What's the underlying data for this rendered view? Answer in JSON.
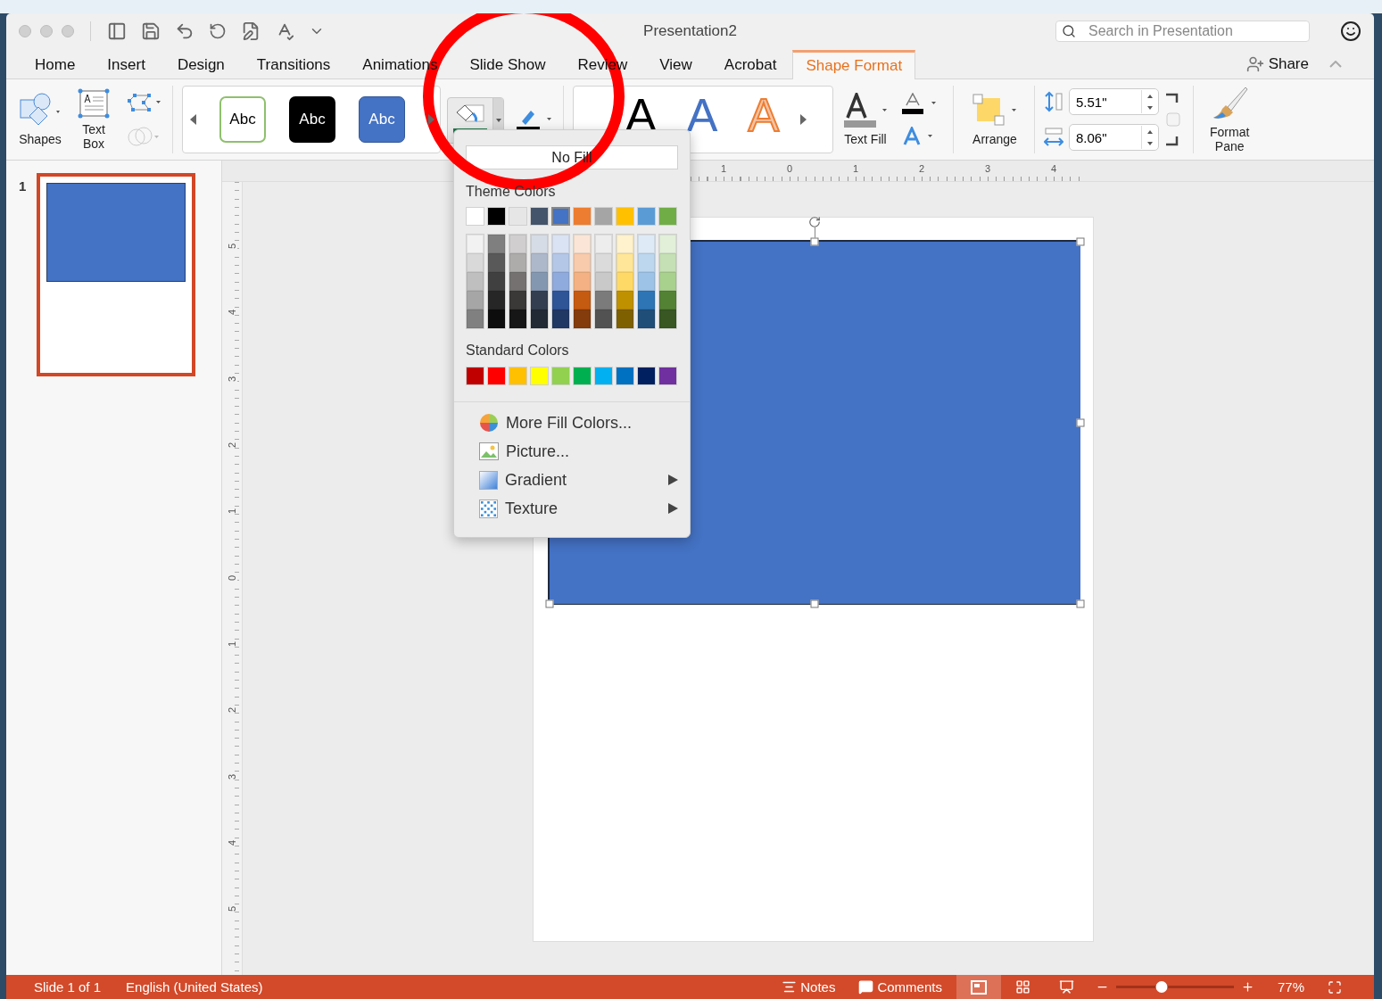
{
  "window": {
    "title": "Presentation2"
  },
  "search": {
    "placeholder": "Search in Presentation"
  },
  "tabs": [
    {
      "label": "Home",
      "selected": false
    },
    {
      "label": "Insert",
      "selected": false
    },
    {
      "label": "Design",
      "selected": false
    },
    {
      "label": "Transitions",
      "selected": false
    },
    {
      "label": "Animations",
      "selected": false
    },
    {
      "label": "Slide Show",
      "selected": false
    },
    {
      "label": "Review",
      "selected": false
    },
    {
      "label": "View",
      "selected": false
    },
    {
      "label": "Acrobat",
      "selected": false
    },
    {
      "label": "Shape Format",
      "selected": true
    }
  ],
  "share": {
    "label": "Share"
  },
  "ribbon": {
    "shapes": {
      "label": "Shapes"
    },
    "text_box": {
      "label": "Text Box"
    },
    "shape_styles": [
      {
        "label": "Abc",
        "kind": "outline"
      },
      {
        "label": "Abc",
        "kind": "dark"
      },
      {
        "label": "Abc",
        "kind": "blue"
      }
    ],
    "wordart": [
      {
        "label": "A",
        "kind": "black"
      },
      {
        "label": "A",
        "kind": "blue"
      },
      {
        "label": "A",
        "kind": "orange"
      }
    ],
    "text_fill": {
      "label": "Text Fill"
    },
    "arrange": {
      "label": "Arrange"
    },
    "size": [
      {
        "kind": "height",
        "value": "5.51\""
      },
      {
        "kind": "width",
        "value": "8.06\""
      }
    ],
    "format_pane": {
      "label": "Format Pane"
    }
  },
  "fill_menu": {
    "no_fill": "No Fill",
    "theme_heading": "Theme Colors",
    "theme_colors": [
      {
        "color": "#ffffff",
        "selected": false,
        "shades": [
          {
            "color": "#f2f2f2"
          },
          {
            "color": "#d9d9d9"
          },
          {
            "color": "#bfbfbf"
          },
          {
            "color": "#a6a6a6"
          },
          {
            "color": "#808080"
          }
        ]
      },
      {
        "color": "#000000",
        "selected": false,
        "shades": [
          {
            "color": "#7f7f7f"
          },
          {
            "color": "#595959"
          },
          {
            "color": "#404040"
          },
          {
            "color": "#262626"
          },
          {
            "color": "#0d0d0d"
          }
        ]
      },
      {
        "color": "#e7e6e6",
        "selected": false,
        "shades": [
          {
            "color": "#d0cece"
          },
          {
            "color": "#aeabab"
          },
          {
            "color": "#757171"
          },
          {
            "color": "#3b3838"
          },
          {
            "color": "#171616"
          }
        ]
      },
      {
        "color": "#44546a",
        "selected": false,
        "shades": [
          {
            "color": "#d6dce5"
          },
          {
            "color": "#adb9ca"
          },
          {
            "color": "#8497b0"
          },
          {
            "color": "#333f50"
          },
          {
            "color": "#222a35"
          }
        ]
      },
      {
        "color": "#4472c4",
        "selected": true,
        "shades": [
          {
            "color": "#dae3f3"
          },
          {
            "color": "#b4c7e7"
          },
          {
            "color": "#8faadc"
          },
          {
            "color": "#2f5597"
          },
          {
            "color": "#203864"
          }
        ]
      },
      {
        "color": "#ed7d31",
        "selected": false,
        "shades": [
          {
            "color": "#fbe5d6"
          },
          {
            "color": "#f8cbad"
          },
          {
            "color": "#f4b183"
          },
          {
            "color": "#c55a11"
          },
          {
            "color": "#843c0c"
          }
        ]
      },
      {
        "color": "#a5a5a5",
        "selected": false,
        "shades": [
          {
            "color": "#ededed"
          },
          {
            "color": "#dbdbdb"
          },
          {
            "color": "#c9c9c9"
          },
          {
            "color": "#7b7b7b"
          },
          {
            "color": "#525252"
          }
        ]
      },
      {
        "color": "#ffc000",
        "selected": false,
        "shades": [
          {
            "color": "#fff2cc"
          },
          {
            "color": "#ffe699"
          },
          {
            "color": "#ffd966"
          },
          {
            "color": "#bf9000"
          },
          {
            "color": "#7f6000"
          }
        ]
      },
      {
        "color": "#5b9bd5",
        "selected": false,
        "shades": [
          {
            "color": "#deebf7"
          },
          {
            "color": "#bdd7ee"
          },
          {
            "color": "#9dc3e6"
          },
          {
            "color": "#2e75b6"
          },
          {
            "color": "#1f4e79"
          }
        ]
      },
      {
        "color": "#70ad47",
        "selected": false,
        "shades": [
          {
            "color": "#e2f0d9"
          },
          {
            "color": "#c5e0b4"
          },
          {
            "color": "#a9d18e"
          },
          {
            "color": "#548235"
          },
          {
            "color": "#385723"
          }
        ]
      }
    ],
    "standard_heading": "Standard Colors",
    "standard_colors": [
      {
        "color": "#c00000"
      },
      {
        "color": "#ff0000"
      },
      {
        "color": "#ffc000"
      },
      {
        "color": "#ffff00"
      },
      {
        "color": "#92d050"
      },
      {
        "color": "#00b050"
      },
      {
        "color": "#00b0f0"
      },
      {
        "color": "#0070c0"
      },
      {
        "color": "#002060"
      },
      {
        "color": "#7030a0"
      }
    ],
    "items": [
      {
        "label": "More Fill Colors...",
        "kind": "palette",
        "submenu": false
      },
      {
        "label": "Picture...",
        "kind": "picture",
        "submenu": false
      },
      {
        "label": "Gradient",
        "kind": "gradient",
        "submenu": true
      },
      {
        "label": "Texture",
        "kind": "texture",
        "submenu": true
      }
    ]
  },
  "slides": [
    {
      "number": "1",
      "selected": true
    }
  ],
  "horizontal_ruler": [
    "1",
    "0",
    "1",
    "2",
    "3",
    "4"
  ],
  "vertical_ruler": [
    "5",
    "4",
    "3",
    "2",
    "1",
    "0",
    "1",
    "2",
    "3",
    "4",
    "5"
  ],
  "status_bar": {
    "slide": "Slide 1 of 1",
    "language": "English (United States)",
    "notes": "Notes",
    "comments": "Comments",
    "views": [
      {
        "kind": "normal",
        "selected": true
      },
      {
        "kind": "sorter",
        "selected": false
      },
      {
        "kind": "show",
        "selected": false
      }
    ],
    "zoom": {
      "label": "77%",
      "level": 0.39
    }
  }
}
